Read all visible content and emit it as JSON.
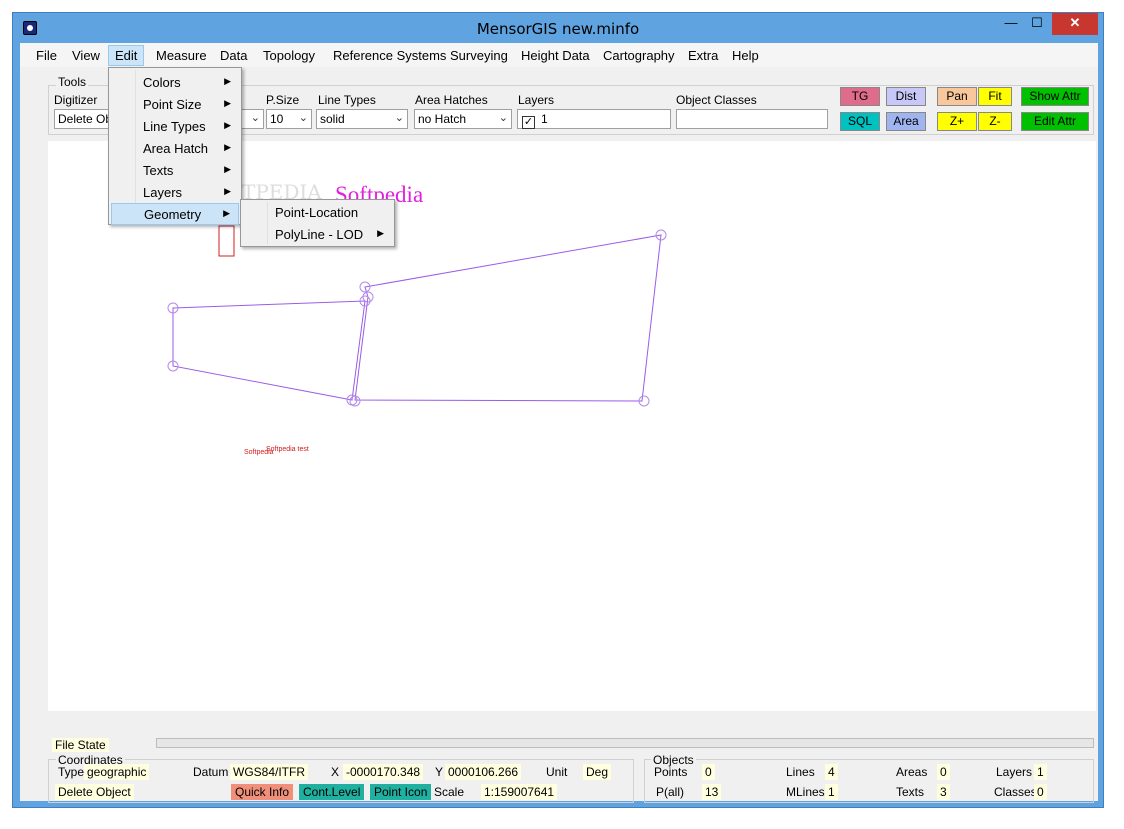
{
  "window": {
    "title": "MensorGIS new.minfo",
    "min": "—",
    "max": "☐",
    "close": "✕"
  },
  "menubar": [
    "File",
    "View",
    "Edit",
    "Measure",
    "Data",
    "Topology",
    "Reference Systems",
    "Surveying",
    "Height Data",
    "Cartography",
    "Extra",
    "Help"
  ],
  "tools": {
    "group_label": "Tools",
    "digitizer_label": "Digitizer",
    "digitizer_value": "Delete Obj",
    "psize_label": "P.Size",
    "psize_value": "10",
    "linetypes_label": "Line Types",
    "linetypes_value": "solid",
    "hatches_label": "Area Hatches",
    "hatches_value": "no Hatch",
    "layers_label": "Layers",
    "layers_value": "1",
    "objclasses_label": "Object Classes",
    "objclasses_value": "",
    "buttons": {
      "tg": "TG",
      "dist": "Dist",
      "pan": "Pan",
      "fit": "Fit",
      "show_attr": "Show Attr",
      "sql": "SQL",
      "area": "Area",
      "zplus": "Z+",
      "zminus": "Z-",
      "edit_attr": "Edit Attr"
    }
  },
  "edit_menu": [
    "Colors",
    "Point Size",
    "Line Types",
    "Area Hatch",
    "Texts",
    "Layers",
    "Geometry"
  ],
  "geometry_submenu": [
    "Point-Location",
    "PolyLine - LOD"
  ],
  "canvas": {
    "watermark": "SOFTPEDIA",
    "softpedia_text": "Softpedia",
    "small_text_1": "Softpedia",
    "small_text_2": "Softpedia test"
  },
  "status": {
    "file_state": "File State",
    "coords_label": "Coordinates",
    "type_label": "Type",
    "type_value": "geographic",
    "datum_label": "Datum",
    "datum_value": "WGS84/ITFR",
    "x_label": "X",
    "x_value": "-0000170.348",
    "y_label": "Y",
    "y_value": "0000106.266",
    "unit_label": "Unit",
    "unit_value": "Deg",
    "mode": "Delete Object",
    "quick_info": "Quick Info",
    "cont_level": "Cont.Level",
    "point_icon": "Point Icon",
    "scale_label": "Scale",
    "scale_value": "1:159007641",
    "objects_label": "Objects",
    "points_label": "Points",
    "points_value": "0",
    "pall_label": "P(all)",
    "pall_value": "13",
    "lines_label": "Lines",
    "lines_value": "4",
    "mlines_label": "MLines",
    "mlines_value": "1",
    "areas_label": "Areas",
    "areas_value": "0",
    "texts_label": "Texts",
    "texts_value": "3",
    "layers_label": "Layers",
    "layers_value": "1",
    "classes_label": "Classes",
    "classes_value": "0"
  },
  "colors": {
    "tg": "#e06c8c",
    "dist": "#c8c8f8",
    "pan": "#f8c89c",
    "fit": "#ffff00",
    "show_attr": "#00c000",
    "sql": "#00c0c0",
    "area": "#a0b4f0",
    "quick_info": "#f0907a",
    "cont_level": "#20b0a0",
    "geometry": "#9b5be8",
    "accent": "#e020e0"
  }
}
